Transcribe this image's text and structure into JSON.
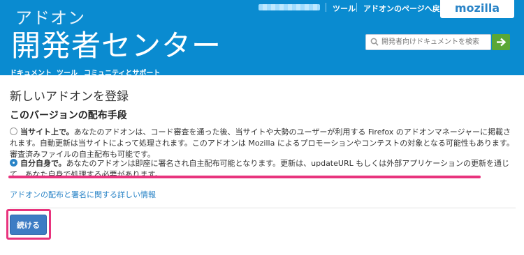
{
  "header": {
    "brand_small": "アドオン",
    "brand_big": "開発者センター",
    "top_links": {
      "tools": "ツール",
      "back_to_addons": "アドオンのページへ戻る"
    },
    "mozilla_tab": "mozilla",
    "search": {
      "placeholder": "開発者向けドキュメントを検索"
    },
    "nav": [
      "ドキュメント",
      "ツール",
      "コミュニティとサポート"
    ]
  },
  "main": {
    "page_title": "新しいアドオンを登録",
    "section_title": "このバージョンの配布手段",
    "options": [
      {
        "label": "当サイト上で。",
        "description": "あなたのアドオンは、コード審査を通った後、当サイトや大勢のユーザーが利用する Firefox のアドオンマネージャーに掲載されます。自動更新は当サイトによって処理されます。このアドオンは Mozilla によるプロモーションやコンテストの対象となる可能性もあります。審査済みファイルの自主配布も可能です。",
        "selected": false
      },
      {
        "label": "自分自身で。",
        "description": "あなたのアドオンは即座に署名され自主配布可能となります。更新は、updateURL もしくは外部アプリケーションの更新を通じて、あなた自身で処理する必要があります。",
        "selected": true
      }
    ],
    "details_link": "アドオンの配布と署名に関する詳しい情報",
    "continue_label": "続ける"
  },
  "colors": {
    "header_bg": "#0a8bd0",
    "accent": "#2a84c7",
    "button": "#3d7cc4",
    "highlight": "#e8337d",
    "search_go": "#5aa735"
  }
}
